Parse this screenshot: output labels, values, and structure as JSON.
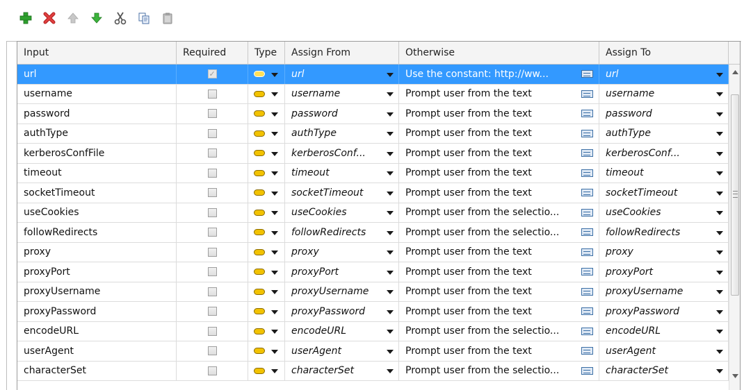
{
  "toolbar": {
    "buttons": [
      {
        "name": "add-row-button",
        "icon": "plus-icon"
      },
      {
        "name": "delete-row-button",
        "icon": "delete-x-icon"
      },
      {
        "name": "move-up-button",
        "icon": "arrow-up-icon"
      },
      {
        "name": "move-down-button",
        "icon": "arrow-down-icon"
      },
      {
        "name": "cut-button",
        "icon": "scissors-icon"
      },
      {
        "name": "copy-button",
        "icon": "copy-icon"
      },
      {
        "name": "paste-button",
        "icon": "paste-icon"
      }
    ]
  },
  "columns": {
    "input": "Input",
    "required": "Required",
    "type": "Type",
    "assign_from": "Assign From",
    "otherwise": "Otherwise",
    "assign_to": "Assign To"
  },
  "rows": [
    {
      "input": "url",
      "required": true,
      "assign_from": "url",
      "otherwise": "Use the constant: http://ww...",
      "assign_to": "url",
      "selected": true
    },
    {
      "input": "username",
      "required": false,
      "assign_from": "username",
      "otherwise": "Prompt user from the text",
      "assign_to": "username"
    },
    {
      "input": "password",
      "required": false,
      "assign_from": "password",
      "otherwise": "Prompt user from the text",
      "assign_to": "password"
    },
    {
      "input": "authType",
      "required": false,
      "assign_from": "authType",
      "otherwise": "Prompt user from the text",
      "assign_to": "authType"
    },
    {
      "input": "kerberosConfFile",
      "required": false,
      "assign_from": "kerberosConf...",
      "otherwise": "Prompt user from the text",
      "assign_to": "kerberosConf..."
    },
    {
      "input": "timeout",
      "required": false,
      "assign_from": "timeout",
      "otherwise": "Prompt user from the text",
      "assign_to": "timeout"
    },
    {
      "input": "socketTimeout",
      "required": false,
      "assign_from": "socketTimeout",
      "otherwise": "Prompt user from the text",
      "assign_to": "socketTimeout"
    },
    {
      "input": "useCookies",
      "required": false,
      "assign_from": "useCookies",
      "otherwise": "Prompt user from the selectio...",
      "assign_to": "useCookies"
    },
    {
      "input": "followRedirects",
      "required": false,
      "assign_from": "followRedirects",
      "otherwise": "Prompt user from the selectio...",
      "assign_to": "followRedirects"
    },
    {
      "input": "proxy",
      "required": false,
      "assign_from": "proxy",
      "otherwise": "Prompt user from the text",
      "assign_to": "proxy"
    },
    {
      "input": "proxyPort",
      "required": false,
      "assign_from": "proxyPort",
      "otherwise": "Prompt user from the text",
      "assign_to": "proxyPort"
    },
    {
      "input": "proxyUsername",
      "required": false,
      "assign_from": "proxyUsername",
      "otherwise": "Prompt user from the text",
      "assign_to": "proxyUsername"
    },
    {
      "input": "proxyPassword",
      "required": false,
      "assign_from": "proxyPassword",
      "otherwise": "Prompt user from the text",
      "assign_to": "proxyPassword"
    },
    {
      "input": "encodeURL",
      "required": false,
      "assign_from": "encodeURL",
      "otherwise": "Prompt user from the selectio...",
      "assign_to": "encodeURL"
    },
    {
      "input": "userAgent",
      "required": false,
      "assign_from": "userAgent",
      "otherwise": "Prompt user from the text",
      "assign_to": "userAgent"
    },
    {
      "input": "characterSet",
      "required": false,
      "assign_from": "characterSet",
      "otherwise": "Prompt user from the selectio...",
      "assign_to": "characterSet"
    }
  ],
  "type_icon": "input-type-icon",
  "colors": {
    "selection": "#3399ff",
    "add": "#2ea12e",
    "delete": "#d42a2a",
    "arrow": "#2f9e2f"
  }
}
